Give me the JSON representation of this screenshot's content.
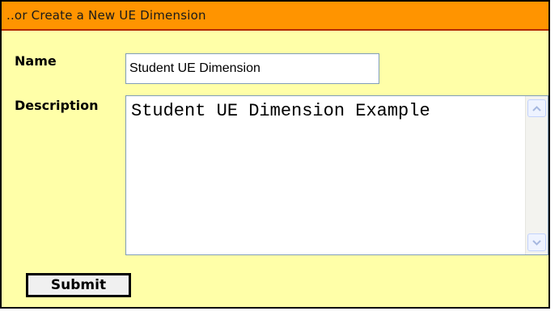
{
  "panel": {
    "header_title": "..or Create a New UE Dimension",
    "colors": {
      "header_bg": "#ff9400",
      "panel_bg": "#ffffa8"
    }
  },
  "form": {
    "name_label": "Name",
    "name_value": "Student UE Dimension",
    "description_label": "Description",
    "description_value": "Student UE Dimension Example",
    "submit_label": "Submit"
  },
  "icons": {
    "scroll_up": "chevron-up-icon",
    "scroll_down": "chevron-down-icon"
  }
}
